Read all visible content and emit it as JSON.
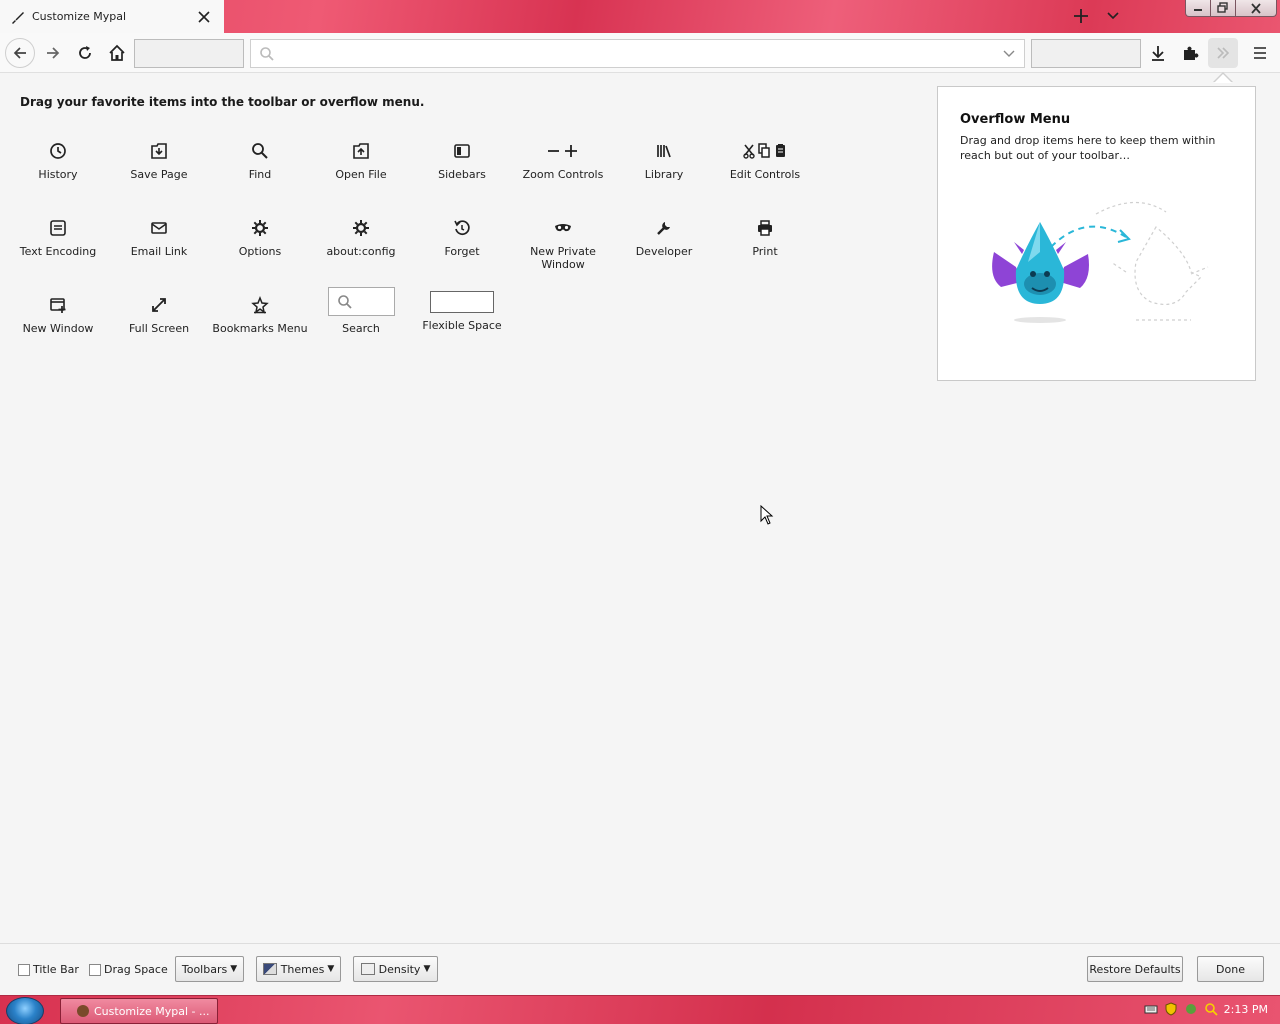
{
  "window": {
    "tab_title": "Customize Mypal"
  },
  "toolbar": {
    "url_placeholder": ""
  },
  "heading": "Drag your favorite items into the toolbar or overflow menu.",
  "palette": {
    "items": [
      {
        "label": "History",
        "icon": "history-icon"
      },
      {
        "label": "Save Page",
        "icon": "save-page-icon"
      },
      {
        "label": "Find",
        "icon": "find-icon"
      },
      {
        "label": "Open File",
        "icon": "open-file-icon"
      },
      {
        "label": "Sidebars",
        "icon": "sidebars-icon"
      },
      {
        "label": "Zoom Controls",
        "icon": "zoom-controls-icon"
      },
      {
        "label": "Library",
        "icon": "library-icon"
      },
      {
        "label": "Edit Controls",
        "icon": "edit-controls-icon"
      },
      {
        "label": "Text Encoding",
        "icon": "text-encoding-icon"
      },
      {
        "label": "Email Link",
        "icon": "email-link-icon"
      },
      {
        "label": "Options",
        "icon": "options-icon"
      },
      {
        "label": "about:config",
        "icon": "about-config-icon"
      },
      {
        "label": "Forget",
        "icon": "forget-icon"
      },
      {
        "label": "New Private Window",
        "icon": "private-window-icon"
      },
      {
        "label": "Developer",
        "icon": "developer-icon"
      },
      {
        "label": "Print",
        "icon": "print-icon"
      },
      {
        "label": "New Window",
        "icon": "new-window-icon"
      },
      {
        "label": "Full Screen",
        "icon": "full-screen-icon"
      },
      {
        "label": "Bookmarks Menu",
        "icon": "bookmarks-menu-icon"
      },
      {
        "label": "Search",
        "icon": "search-widget"
      },
      {
        "label": "Flexible Space",
        "icon": "flexible-space-widget"
      }
    ]
  },
  "overflow_panel": {
    "title": "Overflow Menu",
    "description": "Drag and drop items here to keep them within reach but out of your toolbar…"
  },
  "footer": {
    "title_bar_label": "Title Bar",
    "drag_space_label": "Drag Space",
    "toolbars_label": "Toolbars",
    "themes_label": "Themes",
    "density_label": "Density",
    "restore_label": "Restore Defaults",
    "done_label": "Done"
  },
  "taskbar": {
    "task_label": "Customize Mypal - ...",
    "clock": "2:13 PM"
  },
  "colors": {
    "accent": "#e0435f",
    "overflow_blue": "#2ab7d8",
    "overflow_purple": "#8e44d6"
  }
}
